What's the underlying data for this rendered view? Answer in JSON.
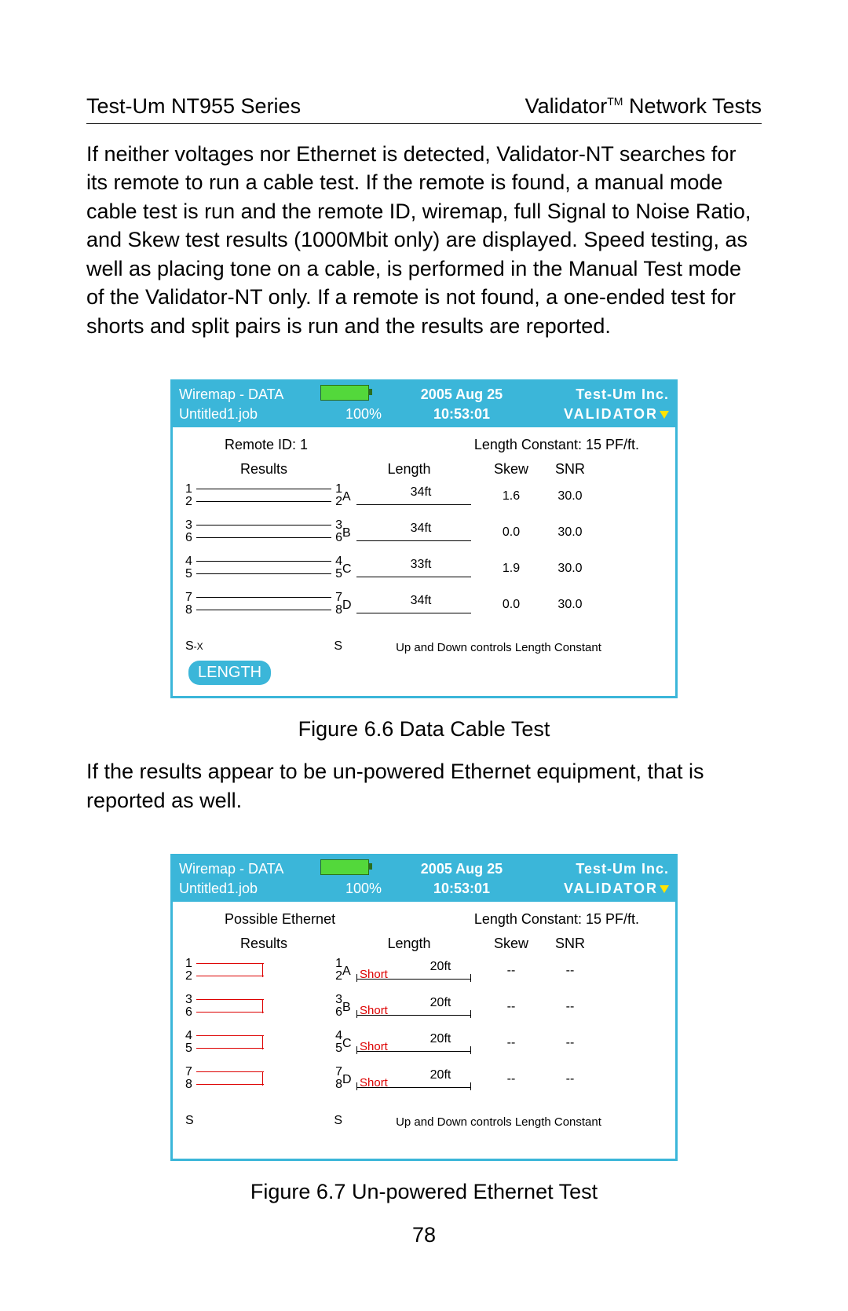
{
  "header": {
    "left": "Test-Um NT955 Series",
    "right_pre": "Validator",
    "right_tm": "TM",
    "right_post": " Network Tests"
  },
  "para1": "If neither voltages nor Ethernet is detected, Validator-NT searches for its remote to run a cable test.  If the remote is found, a manual mode cable test is run and the remote ID, wiremap, full Signal to Noise Ratio, and Skew test results (1000Mbit only) are displayed.  Speed testing, as well as placing tone on a cable, is performed in the Manual Test mode of the Validator-NT only. If a remote is not found, a one-ended test for shorts and split pairs is run and the results are reported.",
  "fig1": {
    "title": "Wiremap - DATA",
    "job": "Untitled1.job",
    "batt": "100%",
    "date": "2005 Aug 25",
    "time": "10:53:01",
    "brand": "Test-Um Inc.",
    "brand_sub": "VALIDATOR",
    "remote": "Remote ID: 1",
    "len_const": "Length Constant: 15 PF/ft.",
    "heads": {
      "results": "Results",
      "length": "Length",
      "skew": "Skew",
      "snr": "SNR"
    },
    "pairs": [
      {
        "pins": [
          "1",
          "2"
        ],
        "pair_lbl": "A",
        "len": "34ft",
        "skew": "1.6",
        "snr": "30.0"
      },
      {
        "pins": [
          "3",
          "6"
        ],
        "pair_lbl": "B",
        "len": "34ft",
        "skew": "0.0",
        "snr": "30.0"
      },
      {
        "pins": [
          "4",
          "5"
        ],
        "pair_lbl": "C",
        "len": "33ft",
        "skew": "1.9",
        "snr": "30.0"
      },
      {
        "pins": [
          "7",
          "8"
        ],
        "pair_lbl": "D",
        "len": "34ft",
        "skew": "0.0",
        "snr": "30.0"
      }
    ],
    "s_left": "S",
    "s_x": "-X",
    "s_right": "S",
    "note": "Up and Down controls Length Constant",
    "btn": "LENGTH",
    "caption": "Figure 6.6 Data Cable Test"
  },
  "para2": "If the results appear to be un-powered Ethernet equipment, that is reported as well.",
  "fig2": {
    "title": "Wiremap - DATA",
    "job": "Untitled1.job",
    "batt": "100%",
    "date": "2005 Aug 25",
    "time": "10:53:01",
    "brand": "Test-Um Inc.",
    "brand_sub": "VALIDATOR",
    "remote": "Possible Ethernet",
    "len_const": "Length Constant: 15 PF/ft.",
    "heads": {
      "results": "Results",
      "length": "Length",
      "skew": "Skew",
      "snr": "SNR"
    },
    "short": "Short",
    "pairs": [
      {
        "pins": [
          "1",
          "2"
        ],
        "pair_lbl": "A",
        "len": "20ft",
        "skew": "--",
        "snr": "--"
      },
      {
        "pins": [
          "3",
          "6"
        ],
        "pair_lbl": "B",
        "len": "20ft",
        "skew": "--",
        "snr": "--"
      },
      {
        "pins": [
          "4",
          "5"
        ],
        "pair_lbl": "C",
        "len": "20ft",
        "skew": "--",
        "snr": "--"
      },
      {
        "pins": [
          "7",
          "8"
        ],
        "pair_lbl": "D",
        "len": "20ft",
        "skew": "--",
        "snr": "--"
      }
    ],
    "s_left": "S",
    "s_right": "S",
    "note": "Up and Down controls Length Constant",
    "caption": "Figure 6.7 Un-powered Ethernet Test"
  },
  "page_num": "78"
}
